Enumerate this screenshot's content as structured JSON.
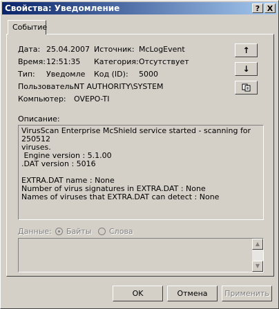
{
  "window": {
    "title": "Свойства: Уведомление"
  },
  "title_buttons": [
    {
      "label": "?"
    },
    {
      "label": "X"
    }
  ],
  "tab": {
    "label": "Событие"
  },
  "fields": {
    "date_label": "Дата:",
    "date_value": "25.04.2007",
    "time_label": "Время:",
    "time_value": "12:51:35",
    "type_label": "Тип:",
    "type_value": "Уведомле",
    "source_label": "Источник:",
    "source_value": "McLogEvent",
    "category_label": "Категория:",
    "category_value": "Отсутствует",
    "code_label": "Код (ID):",
    "code_value": "5000",
    "user_label": "Пользователь:",
    "user_value": "NT AUTHORITY\\SYSTEM",
    "computer_label": "Компьютер:",
    "computer_value": "OVEPO-TI"
  },
  "side_buttons": {
    "up_icon": "↑",
    "down_icon": "↓",
    "copy_icon": "copy-icon"
  },
  "description": {
    "label": "Описание:",
    "text": "VirusScan Enterprise McShield service started - scanning for 250512\nviruses.\n Engine version : 5.1.00\n.DAT version : 5016\n\nEXTRA.DAT name : None\nNumber of virus signatures in EXTRA.DAT : None\nNames of viruses that EXTRA.DAT can detect : None"
  },
  "data_section": {
    "label": "Данные:",
    "bytes_label": "Байты",
    "words_label": "Слова"
  },
  "buttons": {
    "ok": "OK",
    "cancel": "Отмена",
    "apply": "Применить"
  }
}
